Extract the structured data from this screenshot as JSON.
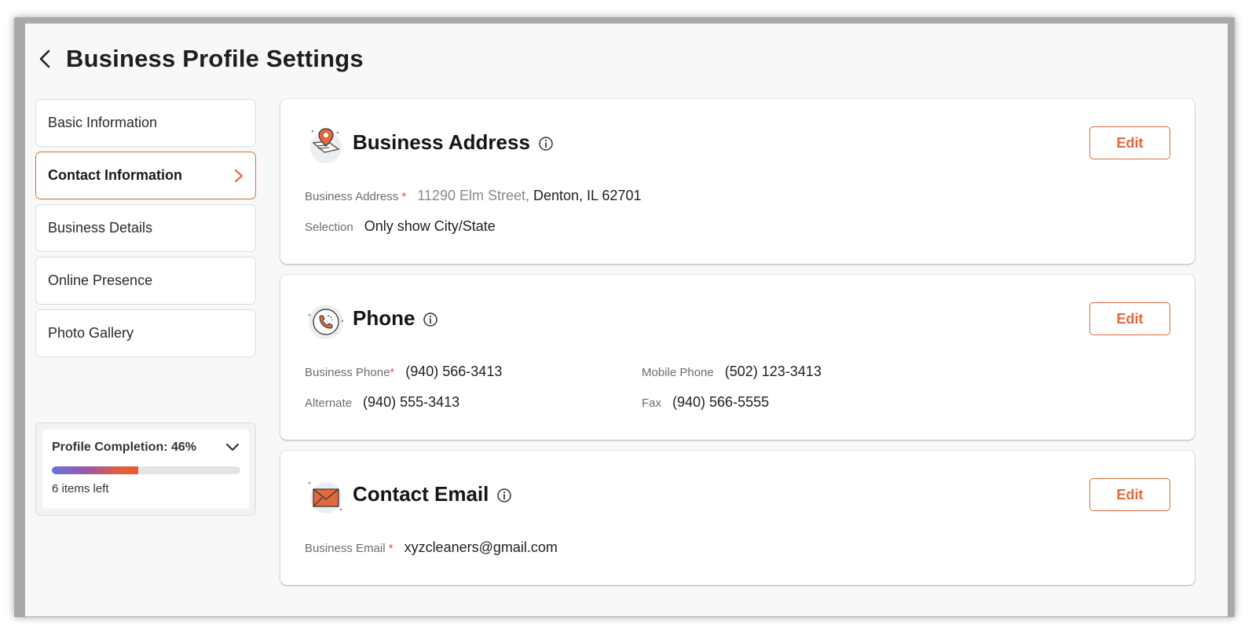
{
  "page": {
    "title": "Business Profile Settings"
  },
  "nav": {
    "items": [
      {
        "label": "Basic Information"
      },
      {
        "label": "Contact Information"
      },
      {
        "label": "Business Details"
      },
      {
        "label": "Online Presence"
      },
      {
        "label": "Photo Gallery"
      }
    ],
    "active_index": 1
  },
  "completion": {
    "label": "Profile Completion: 46%",
    "percent": 46,
    "items_left": "6 items left"
  },
  "address": {
    "title": "Business Address",
    "edit_label": "Edit",
    "address_label": "Business Address",
    "required_mark": "*",
    "street": "11290 Elm Street,",
    "city_state": "Denton, IL 62701",
    "selection_label": "Selection",
    "selection_value": "Only show City/State"
  },
  "phone": {
    "title": "Phone",
    "edit_label": "Edit",
    "business_phone_label": "Business Phone",
    "required_mark": "*",
    "business_phone": "(940) 566-3413",
    "mobile_label": "Mobile Phone",
    "mobile": "(502) 123-3413",
    "alternate_label": "Alternate",
    "alternate": "(940) 555-3413",
    "fax_label": "Fax",
    "fax": "(940) 566-5555"
  },
  "email": {
    "title": "Contact Email",
    "edit_label": "Edit",
    "business_email_label": "Business Email",
    "required_mark": "*",
    "business_email": "xyzcleaners@gmail.com"
  },
  "colors": {
    "accent": "#e06a3e",
    "border": "#d9dbe3",
    "background": "#f8f8f8"
  },
  "icons": {
    "back": "chevron-left-icon",
    "nav_active": "chevron-right-icon",
    "completion_toggle": "chevron-down-icon",
    "info": "info-icon",
    "address": "map-pin-icon",
    "phone": "phone-icon",
    "email": "envelope-icon"
  }
}
